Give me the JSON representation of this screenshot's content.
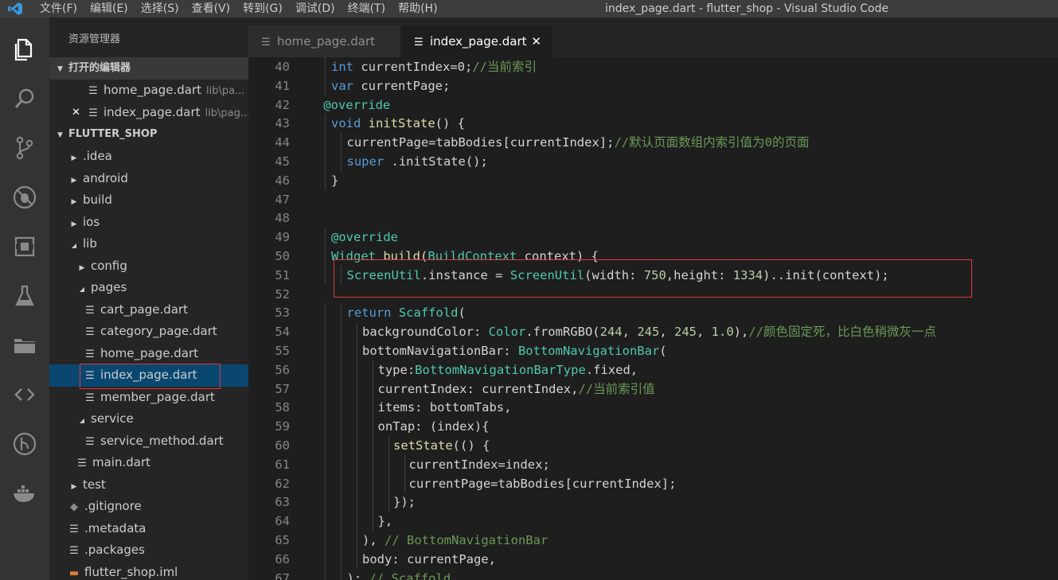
{
  "window": {
    "title": "index_page.dart - flutter_shop - Visual Studio Code",
    "menu": [
      "文件(F)",
      "编辑(E)",
      "选择(S)",
      "查看(V)",
      "转到(G)",
      "调试(D)",
      "终端(T)",
      "帮助(H)"
    ]
  },
  "activity_bar": [
    "explorer",
    "search",
    "source-control",
    "debug",
    "extensions",
    "flask",
    "folders",
    "code",
    "git-history",
    "docker"
  ],
  "sidebar": {
    "title": "资源管理器",
    "open_editors_header": "打开的编辑器",
    "open_editors": [
      {
        "name": "home_page.dart",
        "desc": "lib\\pa..."
      },
      {
        "name": "index_page.dart",
        "desc": "lib\\pag..."
      }
    ],
    "project_header": "FLUTTER_SHOP",
    "tree": [
      {
        "label": ".idea",
        "type": "folder",
        "indent": 0,
        "expanded": false
      },
      {
        "label": "android",
        "type": "folder",
        "indent": 0,
        "expanded": false
      },
      {
        "label": "build",
        "type": "folder",
        "indent": 0,
        "expanded": false
      },
      {
        "label": "ios",
        "type": "folder",
        "indent": 0,
        "expanded": false
      },
      {
        "label": "lib",
        "type": "folder",
        "indent": 0,
        "expanded": true
      },
      {
        "label": "config",
        "type": "folder",
        "indent": 1,
        "expanded": false
      },
      {
        "label": "pages",
        "type": "folder",
        "indent": 1,
        "expanded": true
      },
      {
        "label": "cart_page.dart",
        "type": "file",
        "indent": 2
      },
      {
        "label": "category_page.dart",
        "type": "file",
        "indent": 2
      },
      {
        "label": "home_page.dart",
        "type": "file",
        "indent": 2
      },
      {
        "label": "index_page.dart",
        "type": "file",
        "indent": 2,
        "selected": true
      },
      {
        "label": "member_page.dart",
        "type": "file",
        "indent": 2
      },
      {
        "label": "service",
        "type": "folder",
        "indent": 1,
        "expanded": true
      },
      {
        "label": "service_method.dart",
        "type": "file",
        "indent": 2
      },
      {
        "label": "main.dart",
        "type": "file",
        "indent": 1
      },
      {
        "label": "test",
        "type": "folder",
        "indent": 0,
        "expanded": false
      },
      {
        "label": ".gitignore",
        "type": "git",
        "indent": 0
      },
      {
        "label": ".metadata",
        "type": "file",
        "indent": 0
      },
      {
        "label": ".packages",
        "type": "file",
        "indent": 0
      },
      {
        "label": "flutter_shop.iml",
        "type": "xml",
        "indent": 0
      }
    ]
  },
  "tabs": [
    {
      "label": "home_page.dart",
      "active": false
    },
    {
      "label": "index_page.dart",
      "active": true
    }
  ],
  "editor": {
    "lines": [
      {
        "n": "40",
        "indent": 1,
        "tokens": [
          [
            "kw",
            "int"
          ],
          [
            "",
            "currentIndex=0;"
          ],
          [
            "cm",
            "//当前索引"
          ]
        ]
      },
      {
        "n": "41",
        "indent": 1,
        "tokens": [
          [
            "kw",
            "var"
          ],
          [
            "",
            "currentPage;"
          ]
        ]
      },
      {
        "n": "42",
        "indent": 0,
        "tokens": [
          [
            "an",
            "@override"
          ]
        ]
      },
      {
        "n": "43",
        "indent": 1,
        "tokens": [
          [
            "kw",
            "void"
          ],
          [
            "fn",
            "initState"
          ],
          [
            "",
            "() {"
          ]
        ]
      },
      {
        "n": "44",
        "indent": 2,
        "tokens": [
          [
            "",
            "currentPage=tabBodies[currentIndex];"
          ],
          [
            "cm",
            "//默认页面数组内索引值为0的页面"
          ]
        ]
      },
      {
        "n": "45",
        "indent": 2,
        "tokens": [
          [
            "kw",
            "super"
          ],
          [
            "",
            ".initState();"
          ]
        ]
      },
      {
        "n": "46",
        "indent": 1,
        "tokens": [
          [
            "",
            "}"
          ]
        ]
      },
      {
        "n": "47",
        "indent": 0,
        "tokens": []
      },
      {
        "n": "48",
        "indent": 0,
        "tokens": []
      },
      {
        "n": "49",
        "indent": 1,
        "tokens": [
          [
            "an",
            "@override"
          ]
        ]
      },
      {
        "n": "50",
        "indent": 1,
        "tokens": [
          [
            "ty",
            "Widget"
          ],
          [
            "fn",
            "build"
          ],
          [
            "",
            "("
          ],
          [
            "ty",
            "BuildContext"
          ],
          [
            "",
            " context) {"
          ]
        ]
      },
      {
        "n": "51",
        "indent": 2,
        "tokens": [
          [
            "ty",
            "ScreenUtil"
          ],
          [
            "",
            ".instance = "
          ],
          [
            "ty",
            "ScreenUtil"
          ],
          [
            "",
            "(width: "
          ],
          [
            "num",
            "750"
          ],
          [
            "",
            ",height: "
          ],
          [
            "num",
            "1334"
          ],
          [
            "",
            ")..init(context);"
          ]
        ]
      },
      {
        "n": "52",
        "indent": 0,
        "tokens": []
      },
      {
        "n": "53",
        "indent": 2,
        "tokens": [
          [
            "kw",
            "return"
          ],
          [
            "ty",
            "Scaffold"
          ],
          [
            "",
            "("
          ]
        ]
      },
      {
        "n": "54",
        "indent": 3,
        "tokens": [
          [
            "",
            "backgroundColor: "
          ],
          [
            "ty",
            "Color"
          ],
          [
            "",
            ".fromRGBO("
          ],
          [
            "num",
            "244"
          ],
          [
            "",
            ", "
          ],
          [
            "num",
            "245"
          ],
          [
            "",
            ", "
          ],
          [
            "num",
            "245"
          ],
          [
            "",
            ", "
          ],
          [
            "num",
            "1.0"
          ],
          [
            "",
            "),"
          ],
          [
            "cm",
            "//颜色固定死，比白色稍微灰一点"
          ]
        ]
      },
      {
        "n": "55",
        "indent": 3,
        "tokens": [
          [
            "",
            "bottomNavigationBar: "
          ],
          [
            "ty",
            "BottomNavigationBar"
          ],
          [
            "",
            "("
          ]
        ]
      },
      {
        "n": "56",
        "indent": 4,
        "tokens": [
          [
            "",
            "type:"
          ],
          [
            "ty",
            "BottomNavigationBarType"
          ],
          [
            "",
            ".fixed,"
          ]
        ]
      },
      {
        "n": "57",
        "indent": 4,
        "tokens": [
          [
            "",
            "currentIndex: currentIndex,"
          ],
          [
            "cm",
            "//当前索引值"
          ]
        ]
      },
      {
        "n": "58",
        "indent": 4,
        "tokens": [
          [
            "",
            "items: bottomTabs,"
          ]
        ]
      },
      {
        "n": "59",
        "indent": 4,
        "tokens": [
          [
            "",
            "onTap: (index){"
          ]
        ]
      },
      {
        "n": "60",
        "indent": 5,
        "tokens": [
          [
            "fn",
            "setState"
          ],
          [
            "",
            "(() {"
          ]
        ]
      },
      {
        "n": "61",
        "indent": 6,
        "tokens": [
          [
            "",
            "currentIndex=index;"
          ]
        ]
      },
      {
        "n": "62",
        "indent": 6,
        "tokens": [
          [
            "",
            "currentPage=tabBodies[currentIndex];"
          ]
        ]
      },
      {
        "n": "63",
        "indent": 5,
        "tokens": [
          [
            "",
            "});"
          ]
        ]
      },
      {
        "n": "64",
        "indent": 4,
        "tokens": [
          [
            "",
            "},"
          ]
        ]
      },
      {
        "n": "65",
        "indent": 3,
        "tokens": [
          [
            "",
            "), "
          ],
          [
            "cm",
            "// BottomNavigationBar"
          ]
        ]
      },
      {
        "n": "66",
        "indent": 3,
        "tokens": [
          [
            "",
            "body: currentPage,"
          ]
        ]
      },
      {
        "n": "67",
        "indent": 2,
        "tokens": [
          [
            "",
            "); "
          ],
          [
            "cm",
            "// Scaffold"
          ]
        ]
      }
    ]
  }
}
